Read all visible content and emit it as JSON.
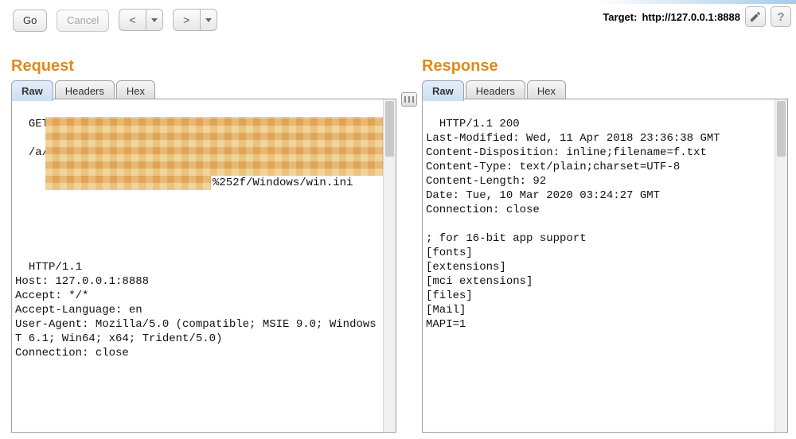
{
  "toolbar": {
    "go_label": "Go",
    "cancel_label": "Cancel"
  },
  "target": {
    "lead": "Target:",
    "url": "http://127.0.0.1:8888"
  },
  "titles": {
    "request": "Request",
    "response": "Response"
  },
  "tabs": {
    "raw": "Raw",
    "headers": "Headers",
    "hex": "Hex"
  },
  "request_body": {
    "line1": "GET",
    "line2_prefix": "/a/b/",
    "redacted_tail": "%252f/Windows/win.ini",
    "rest": "HTTP/1.1\nHost: 127.0.0.1:8888\nAccept: */*\nAccept-Language: en\nUser-Agent: Mozilla/5.0 (compatible; MSIE 9.0; Windows NT 6.1; Win64; x64; Trident/5.0)\nConnection: close\n"
  },
  "response_body": "HTTP/1.1 200\nLast-Modified: Wed, 11 Apr 2018 23:36:38 GMT\nContent-Disposition: inline;filename=f.txt\nContent-Type: text/plain;charset=UTF-8\nContent-Length: 92\nDate: Tue, 10 Mar 2020 03:24:27 GMT\nConnection: close\n\n; for 16-bit app support\n[fonts]\n[extensions]\n[mci extensions]\n[files]\n[Mail]\nMAPI=1\n"
}
